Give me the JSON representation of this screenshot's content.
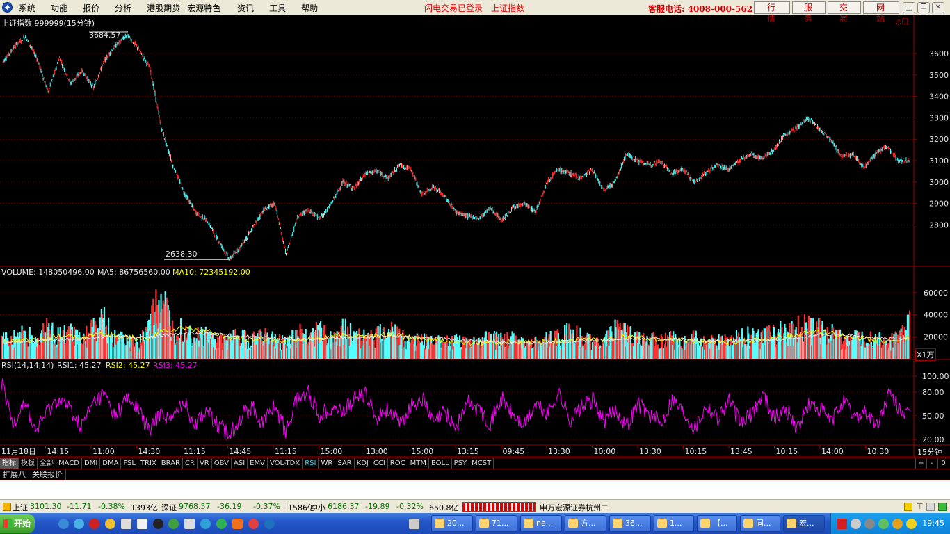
{
  "menu": {
    "items": [
      "系统",
      "功能",
      "报价",
      "分析",
      "港股期货",
      "宏源特色",
      "资讯",
      "工具",
      "帮助"
    ],
    "login_status": "闪电交易已登录",
    "index_name": "上证指数",
    "hotline": "客服电话: 4008-000-562",
    "buttons": [
      "行 情",
      "服 务",
      "交 易",
      "网 站"
    ]
  },
  "chart_header": {
    "title": "上证指数 999999(15分钟)",
    "high_label": "3684.57",
    "low_label": "2638.30"
  },
  "volume_header": {
    "volume": "VOLUME: 148050496.00",
    "ma5": "MA5: 86756560.00",
    "ma10": "MA10: 72345192.00",
    "unit": "X1万"
  },
  "rsi_header": {
    "name": "RSI(14,14,14)",
    "rsi1": "RSI1: 45.27",
    "rsi2": "RSI2: 45.27",
    "rsi3": "RSI3: 45.27"
  },
  "chart_data": [
    {
      "type": "line",
      "panel": "price",
      "y_ticks": [
        "3600",
        "3500",
        "3400",
        "3300",
        "3200",
        "3100",
        "3000",
        "2900",
        "2800"
      ],
      "ylim": [
        2610,
        3720
      ],
      "x_labels": [
        "11月18日",
        "14:15",
        "11:00",
        "14:30",
        "11:15",
        "14:45",
        "11:15",
        "15:00",
        "13:00",
        "15:00",
        "13:15",
        "09:45",
        "13:30",
        "10:00",
        "13:30",
        "10:15",
        "13:45",
        "10:15",
        "14:00",
        "10:30"
      ],
      "x_label_last": "15分钟",
      "points": [
        [
          0,
          3560
        ],
        [
          1,
          3630
        ],
        [
          2,
          3680
        ],
        [
          3,
          3580
        ],
        [
          4,
          3420
        ],
        [
          5,
          3580
        ],
        [
          6,
          3460
        ],
        [
          7,
          3520
        ],
        [
          8,
          3440
        ],
        [
          9,
          3570
        ],
        [
          10,
          3640
        ],
        [
          11,
          3684.57
        ],
        [
          12,
          3620
        ],
        [
          13,
          3530
        ],
        [
          14,
          3250
        ],
        [
          15,
          3080
        ],
        [
          16,
          2950
        ],
        [
          17,
          2860
        ],
        [
          18,
          2820
        ],
        [
          19,
          2730
        ],
        [
          20,
          2638.3
        ],
        [
          21,
          2700
        ],
        [
          22,
          2780
        ],
        [
          23,
          2870
        ],
        [
          24,
          2900
        ],
        [
          25,
          2660
        ],
        [
          26,
          2840
        ],
        [
          27,
          2870
        ],
        [
          28,
          2830
        ],
        [
          29,
          2900
        ],
        [
          30,
          3000
        ],
        [
          31,
          2970
        ],
        [
          32,
          3040
        ],
        [
          33,
          3050
        ],
        [
          34,
          3020
        ],
        [
          35,
          3080
        ],
        [
          36,
          3060
        ],
        [
          37,
          2940
        ],
        [
          38,
          2980
        ],
        [
          39,
          2930
        ],
        [
          40,
          2860
        ],
        [
          41,
          2840
        ],
        [
          42,
          2830
        ],
        [
          43,
          2880
        ],
        [
          44,
          2820
        ],
        [
          45,
          2880
        ],
        [
          46,
          2900
        ],
        [
          47,
          2860
        ],
        [
          48,
          3000
        ],
        [
          49,
          3060
        ],
        [
          50,
          3040
        ],
        [
          51,
          3020
        ],
        [
          52,
          3060
        ],
        [
          53,
          2960
        ],
        [
          54,
          3000
        ],
        [
          55,
          3130
        ],
        [
          56,
          3100
        ],
        [
          57,
          3080
        ],
        [
          58,
          3100
        ],
        [
          59,
          3040
        ],
        [
          60,
          3060
        ],
        [
          61,
          3000
        ],
        [
          62,
          3040
        ],
        [
          63,
          3080
        ],
        [
          64,
          3060
        ],
        [
          65,
          3100
        ],
        [
          66,
          3130
        ],
        [
          67,
          3110
        ],
        [
          68,
          3150
        ],
        [
          69,
          3220
        ],
        [
          70,
          3250
        ],
        [
          71,
          3300
        ],
        [
          72,
          3250
        ],
        [
          73,
          3200
        ],
        [
          74,
          3120
        ],
        [
          75,
          3130
        ],
        [
          76,
          3070
        ],
        [
          77,
          3130
        ],
        [
          78,
          3170
        ],
        [
          79,
          3100
        ],
        [
          80,
          3101.3
        ]
      ]
    },
    {
      "type": "bar",
      "panel": "volume",
      "y_ticks": [
        "60000",
        "40000",
        "20000"
      ],
      "ylim": [
        0,
        72000
      ],
      "series": [
        {
          "name": "VOLUME",
          "values": [
            16000,
            18000,
            22000,
            14000,
            26000,
            19000,
            21000,
            17000,
            24000,
            31000,
            18000,
            15000,
            12000,
            28000,
            52000,
            24000,
            27000,
            18000,
            20000,
            14000,
            17000,
            19000,
            15000,
            21000,
            16000,
            14000,
            22000,
            18000,
            24000,
            19000,
            25000,
            20000,
            17000,
            22000,
            24000,
            19000,
            14000,
            17000,
            13000,
            15000,
            16000,
            12000,
            14000,
            18000,
            15000,
            17000,
            13000,
            14000,
            16000,
            19000,
            22000,
            18000,
            14000,
            16000,
            24000,
            21000,
            17000,
            19000,
            14000,
            18000,
            15000,
            17000,
            13000,
            16000,
            15000,
            18000,
            20000,
            17000,
            24000,
            22000,
            26000,
            28000,
            24000,
            21000,
            18000,
            17000,
            16000,
            18000,
            15000,
            17000,
            30000
          ]
        },
        {
          "name": "MA5",
          "values": [
            15000,
            16000,
            17000,
            17000,
            19000,
            20000,
            20000,
            19000,
            21000,
            22000,
            21000,
            20000,
            18000,
            19000,
            25000,
            26000,
            28000,
            27000,
            25000,
            22000,
            19000,
            18000,
            17000,
            18000,
            17000,
            17000,
            18000,
            18000,
            19000,
            20000,
            21000,
            21000,
            20000,
            21000,
            22000,
            21000,
            19000,
            18000,
            17000,
            16000,
            15000,
            14000,
            14000,
            15000,
            15000,
            15000,
            15000,
            15000,
            15000,
            16000,
            17000,
            18000,
            17000,
            17000,
            19000,
            20000,
            19000,
            18000,
            17000,
            18000,
            17000,
            16000,
            15000,
            15000,
            15000,
            16000,
            17000,
            17000,
            19000,
            20000,
            22000,
            24000,
            24000,
            23000,
            21000,
            20000,
            18000,
            17000,
            16000,
            17000,
            19000
          ]
        },
        {
          "name": "MA10",
          "values": [
            14000,
            15000,
            15500,
            16000,
            17000,
            17500,
            18000,
            18500,
            19000,
            20000,
            20500,
            20500,
            19500,
            19500,
            21000,
            22000,
            23000,
            23000,
            23000,
            22500,
            21500,
            21000,
            20000,
            19500,
            18500,
            18000,
            17500,
            17500,
            18000,
            18500,
            19000,
            19500,
            20000,
            20500,
            21000,
            21000,
            20000,
            19500,
            19000,
            18500,
            17500,
            16500,
            16000,
            15500,
            15000,
            14800,
            14700,
            14600,
            14800,
            15200,
            16000,
            16600,
            16800,
            17000,
            17600,
            18200,
            18500,
            18300,
            18000,
            18000,
            17600,
            17000,
            16400,
            16200,
            16000,
            16200,
            16500,
            16700,
            17400,
            18000,
            19200,
            20500,
            21500,
            22000,
            21800,
            21200,
            20500,
            19500,
            18400,
            17800,
            18200
          ]
        }
      ]
    },
    {
      "type": "line",
      "panel": "rsi",
      "y_ticks": [
        "100.00",
        "80.00",
        "50.00",
        "20.00"
      ],
      "ylim": [
        14,
        108
      ],
      "series": [
        {
          "name": "RSI",
          "values": [
            92,
            40,
            70,
            30,
            55,
            72,
            60,
            35,
            65,
            78,
            50,
            72,
            60,
            30,
            55,
            45,
            70,
            40,
            58,
            38,
            26,
            48,
            62,
            40,
            65,
            30,
            72,
            80,
            50,
            62,
            55,
            70,
            78,
            48,
            60,
            38,
            62,
            72,
            40,
            55,
            35,
            68,
            58,
            42,
            72,
            50,
            38,
            65,
            52,
            80,
            45,
            60,
            70,
            42,
            58,
            38,
            66,
            52,
            40,
            72,
            55,
            35,
            64,
            48,
            70,
            40,
            52,
            78,
            46,
            60,
            34,
            64,
            58,
            42,
            70,
            48,
            56,
            36,
            76,
            60,
            45.27
          ]
        }
      ]
    }
  ],
  "tabs": [
    "指标",
    "模板",
    "全部",
    "MACD",
    "DMI",
    "DMA",
    "FSL",
    "TRIX",
    "BRAR",
    "CR",
    "VR",
    "OBV",
    "ASI",
    "EMV",
    "VOL-TDX",
    "RSI",
    "WR",
    "SAR",
    "KDJ",
    "CCI",
    "ROC",
    "MTM",
    "BOLL",
    "PSY",
    "MCST"
  ],
  "active_tab": "RSI",
  "zoom": [
    "+",
    "-",
    "0"
  ],
  "expand_bar": [
    "扩展八",
    "关联报价"
  ],
  "status": {
    "sh_name": "上证",
    "sh_value": "3101.30",
    "sh_change": "-11.71",
    "sh_pct": "-0.38%",
    "sh_amount": "1393亿",
    "sz_name": "深证",
    "sz_value": "9768.57",
    "sz_change": "-36.19",
    "sz_pct": "-0.37%",
    "sz_amount": "1586亿",
    "zx_name": "中小",
    "zx_value": "6186.37",
    "zx_change": "-19.89",
    "zx_pct": "-0.32%",
    "zx_amount": "650.8亿",
    "broker": "申万宏源证券杭州二"
  },
  "taskbar": {
    "start": "开始",
    "tasks": [
      "20...",
      "71...",
      "ne...",
      "方...",
      "36...",
      "1...",
      "【...",
      "同...",
      "宏..."
    ],
    "clock": "19:45"
  },
  "colors": {
    "up": "#ff3232",
    "down": "#54ffff",
    "ma5": "#ffff00",
    "ma10": "#ff00ff",
    "axis": "#a00000",
    "grid": "#6a0000"
  }
}
